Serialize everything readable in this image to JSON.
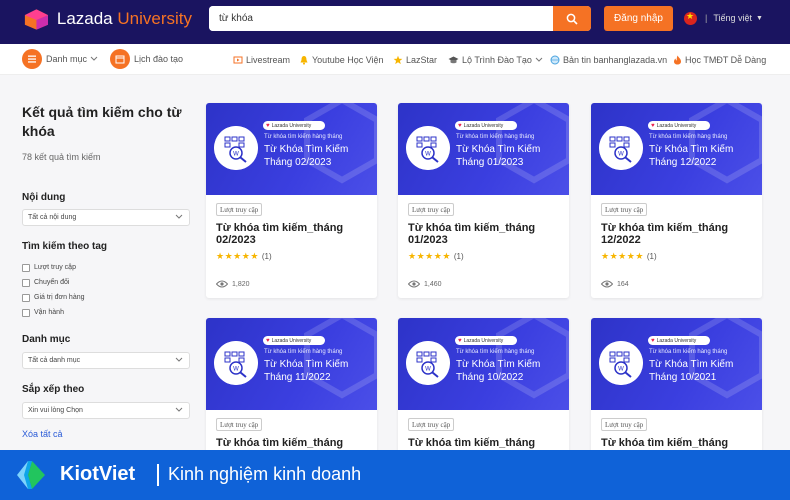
{
  "header": {
    "logo_primary": "Lazada",
    "logo_secondary": "University",
    "search_value": "từ khóa",
    "login_label": "Đăng nhập",
    "language_label": "Tiếng việt"
  },
  "subnav": {
    "categories_label": "Danh mục",
    "schedule_label": "Lịch đào tạo",
    "links": [
      {
        "label": "Livestream",
        "icon": "livestream-icon"
      },
      {
        "label": "Youtube Học Viện",
        "icon": "bell-icon"
      },
      {
        "label": "LazStar",
        "icon": "star-icon"
      },
      {
        "label": "Lộ Trình Đào Tạo",
        "icon": "graduation-cap-icon"
      },
      {
        "label": "Bản tin banhanglazada.vn",
        "icon": "globe-icon"
      },
      {
        "label": "Học TMĐT Dễ Dàng",
        "icon": "fire-icon"
      }
    ]
  },
  "sidebar": {
    "title": "Kết quả tìm kiếm cho từ khóa",
    "result_count": "78 kết quả tìm kiếm",
    "content_label": "Nội dung",
    "content_select": "Tất cả nội dung",
    "tag_label": "Tìm kiếm theo tag",
    "tags": [
      "Lượt truy cập",
      "Chuyển đổi",
      "Giá trị đơn hàng",
      "Vận hành"
    ],
    "category_label": "Danh mục",
    "category_select": "Tất cả danh mục",
    "sort_label": "Sắp xếp theo",
    "sort_select": "Xin vui lòng Chọn",
    "clear_label": "Xóa tất cả"
  },
  "banner_common": {
    "pill": "Lazada University",
    "subtitle": "Từ khóa tìm kiếm hàng tháng"
  },
  "cards": [
    {
      "banner_title": "Từ Khóa Tìm Kiếm Tháng 02/2023",
      "tag": "Lượt truy cập",
      "title": "Từ khóa tìm kiếm_tháng 02/2023",
      "rating_count": "(1)",
      "views": "1,820"
    },
    {
      "banner_title": "Từ Khóa Tìm Kiếm Tháng 01/2023",
      "tag": "Lượt truy cập",
      "title": "Từ khóa tìm kiếm_tháng 01/2023",
      "rating_count": "(1)",
      "views": "1,460"
    },
    {
      "banner_title": "Từ Khóa Tìm Kiếm Tháng 12/2022",
      "tag": "Lượt truy cập",
      "title": "Từ khóa tìm kiếm_tháng 12/2022",
      "rating_count": "(1)",
      "views": "164"
    },
    {
      "banner_title": "Từ Khóa Tìm Kiếm Tháng 11/2022",
      "tag": "Lượt truy cập",
      "title": "Từ khóa tìm kiếm_tháng",
      "rating_count": "",
      "views": ""
    },
    {
      "banner_title": "Từ Khóa Tìm Kiếm Tháng 10/2022",
      "tag": "Lượt truy cập",
      "title": "Từ khóa tìm kiếm_tháng",
      "rating_count": "",
      "views": ""
    },
    {
      "banner_title": "Từ Khóa Tìm Kiếm Tháng 10/2021",
      "tag": "Lượt truy cập",
      "title": "Từ khóa tìm kiếm_tháng",
      "rating_count": "",
      "views": ""
    }
  ],
  "brand_bar": {
    "name": "KiotViet",
    "tagline": "Kinh nghiệm kinh doanh"
  },
  "colors": {
    "header_bg": "#1a1460",
    "accent": "#f57224",
    "banner_blue": "#3b3fe0",
    "star": "#f7b500",
    "brand_blue": "#0f62d8"
  }
}
